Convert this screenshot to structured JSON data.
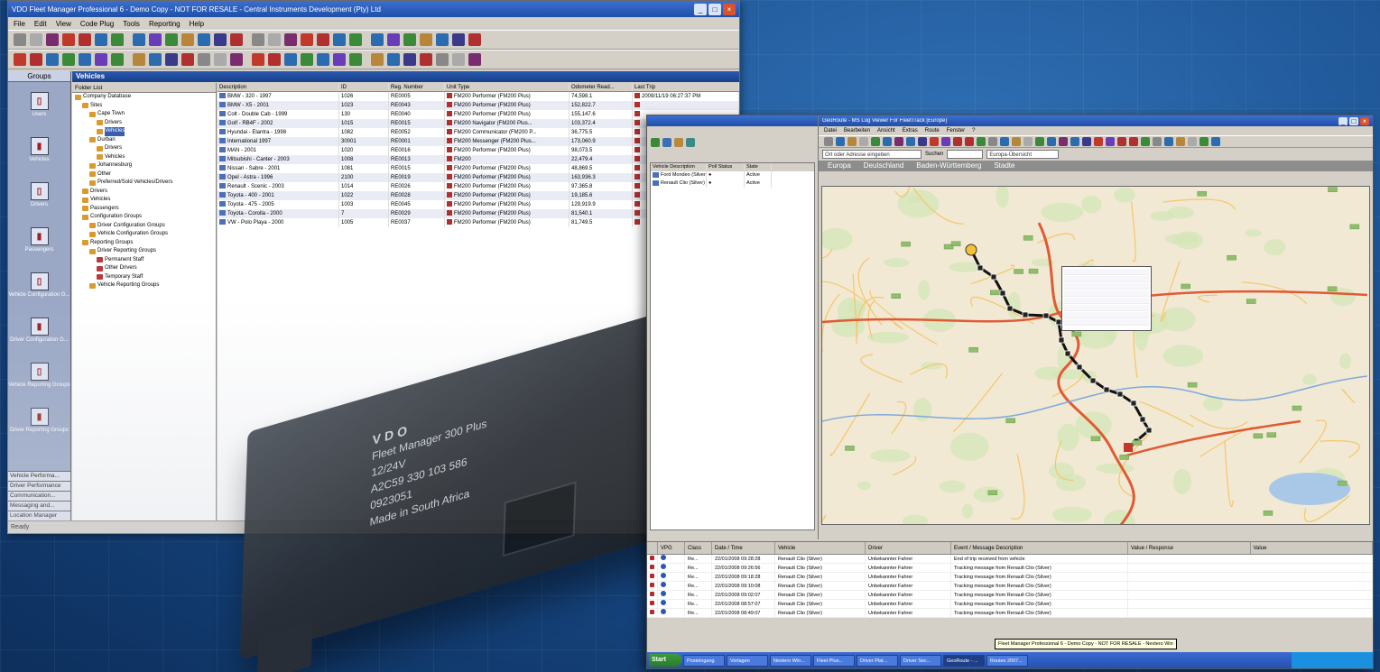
{
  "window1": {
    "title": "VDO Fleet Manager Professional 6 - Demo Copy - NOT FOR RESALE - Central Instruments Development (Pty) Ltd",
    "menu": [
      "File",
      "Edit",
      "View",
      "Code Plug",
      "Tools",
      "Reporting",
      "Help"
    ],
    "nav_header": "Groups",
    "nav_items": [
      "Users",
      "Vehicles",
      "Drivers",
      "Passengers",
      "Vehicle Configuration G...",
      "Driver Configuration G...",
      "Vehicle Reporting Groups",
      "Driver Reporting Groups"
    ],
    "nav_buttons": [
      "Vehicle Performa...",
      "Driver Performance",
      "Communication...",
      "Messaging and...",
      "Location Manager"
    ],
    "pane_title": "Vehicles",
    "folder_list_header": "Folder List",
    "tree": [
      {
        "label": "Company Database",
        "indent": 0
      },
      {
        "label": "Sites",
        "indent": 1
      },
      {
        "label": "Cape Town",
        "indent": 2
      },
      {
        "label": "Drivers",
        "indent": 3
      },
      {
        "label": "Vehicles",
        "indent": 3
      },
      {
        "label": "Durban",
        "indent": 2
      },
      {
        "label": "Drivers",
        "indent": 3
      },
      {
        "label": "Vehicles",
        "indent": 3
      },
      {
        "label": "Johannesburg",
        "indent": 2
      },
      {
        "label": "Other",
        "indent": 2
      },
      {
        "label": "Preferred/Sold Vehicles/Drivers",
        "indent": 2
      },
      {
        "label": "Drivers",
        "indent": 1
      },
      {
        "label": "Vehicles",
        "indent": 1
      },
      {
        "label": "Passengers",
        "indent": 1
      },
      {
        "label": "Configuration Groups",
        "indent": 1
      },
      {
        "label": "Driver Configuration Groups",
        "indent": 2
      },
      {
        "label": "Vehicle Configuration Groups",
        "indent": 2
      },
      {
        "label": "Reporting Groups",
        "indent": 1
      },
      {
        "label": "Driver Reporting Groups",
        "indent": 2
      },
      {
        "label": "Permanent Staff",
        "indent": 3
      },
      {
        "label": "Other Drivers",
        "indent": 3
      },
      {
        "label": "Temporary Staff",
        "indent": 3
      },
      {
        "label": "Vehicle Reporting Groups",
        "indent": 2
      }
    ],
    "table_headers": [
      "Description",
      "ID",
      "Reg. Number",
      "Unit Type",
      "Odometer Read...",
      "Last Trip"
    ],
    "table_rows": [
      [
        "BMW - 320 - 1997",
        "1026",
        "RE0005",
        "FM200 Performer (FM200 Plus)",
        "74,598.1",
        "2009/11/19 06:27:37 PM"
      ],
      [
        "BMW - X5 - 2001",
        "1023",
        "RE0043",
        "FM200 Performer (FM200 Plus)",
        "152,822.7",
        ""
      ],
      [
        "Colt - Double Cab - 1999",
        "130",
        "RE0040",
        "FM200 Performer (FM200 Plus)",
        "155,147.6",
        ""
      ],
      [
        "Golf - RB4F - 2002",
        "1015",
        "RE0015",
        "FM200 Navigator (FM200 Plus...",
        "103,372.4",
        ""
      ],
      [
        "Hyundai - Elantra - 1998",
        "1082",
        "RE0052",
        "FM200 Communicator (FM200 P...",
        "36,775.5",
        ""
      ],
      [
        "International 1997",
        "30001",
        "RE0001",
        "FM200 Messenger (FM200 Plus...",
        "173,060.9",
        ""
      ],
      [
        "MAN - 2001",
        "1020",
        "RE0016",
        "FM200 Performer (FM200 Plus)",
        "98,073.5",
        ""
      ],
      [
        "Mitsubishi - Canter - 2003",
        "1008",
        "RE0013",
        "FM200",
        "22,479.4",
        ""
      ],
      [
        "Nissan - Sabre - 2001",
        "1081",
        "RE0015",
        "FM200 Performer (FM200 Plus)",
        "48,869.5",
        ""
      ],
      [
        "Opel - Astra - 1996",
        "2100",
        "RE0019",
        "FM200 Performer (FM200 Plus)",
        "163,936.3",
        ""
      ],
      [
        "Renault - Scenic - 2003",
        "1014",
        "RE0026",
        "FM200 Performer (FM200 Plus)",
        "97,365.8",
        ""
      ],
      [
        "Toyota - 400 - 2001",
        "1022",
        "RE0028",
        "FM200 Performer (FM200 Plus)",
        "19,185.6",
        ""
      ],
      [
        "Toyota - 475 - 2005",
        "1003",
        "RE0045",
        "FM200 Performer (FM200 Plus)",
        "129,919.9",
        ""
      ],
      [
        "Toyota - Corolla - 2000",
        "7",
        "RE0029",
        "FM200 Performer (FM200 Plus)",
        "81,540.1",
        ""
      ],
      [
        "VW - Polo Playa - 2000",
        "1005",
        "RE0037",
        "FM200 Performer (FM200 Plus)",
        "81,749.5",
        ""
      ]
    ],
    "status": "Ready"
  },
  "device": {
    "brand": "VDO",
    "line1": "Fleet Manager 300 Plus",
    "line2": "12/24V",
    "line3": "A2C59 330 103 586",
    "serial": "0923051",
    "origin": "Made in South Africa"
  },
  "window2": {
    "left_panel": {
      "headers": [
        "Vehicle Description",
        "Poll Status",
        "State"
      ],
      "rows": [
        [
          "Ford Mondeo (Silver)",
          "",
          "Active"
        ],
        [
          "Renault Clio (Silver)",
          "",
          "Active"
        ]
      ]
    },
    "map_window": {
      "title": "GeoRoute - MS Log Viewer For FleetTrack [Europe]",
      "menu": [
        "Datei",
        "Bearbeiten",
        "Ansicht",
        "Extras",
        "Route",
        "Fenster",
        "?"
      ],
      "address_placeholder": "Ort oder Adresse eingeben",
      "search_label": "Suchen",
      "zoom_value": "Europa-Übersicht",
      "breadcrumb": [
        "Europa",
        "Deutschland",
        "Baden-Württemberg",
        "Stadte"
      ]
    },
    "events": {
      "headers": [
        "",
        "VPG",
        "Class",
        "Date / Time",
        "Vehicle",
        "Driver",
        "Event / Message Description",
        "Value / Response",
        "Value"
      ],
      "rows": [
        [
          "I",
          "Re...",
          "22/01/2008 09:28:28",
          "Renault Clio (Silver)",
          "Unbekannter Fahrer",
          "End of trip received from vehicle"
        ],
        [
          "I",
          "Re...",
          "22/01/2008 09:26:56",
          "Renault Clio (Silver)",
          "Unbekannter Fahrer",
          "Tracking message from Renault Clio (Silver)"
        ],
        [
          "I",
          "Re...",
          "22/01/2008 09:18:28",
          "Renault Clio (Silver)",
          "Unbekannter Fahrer",
          "Tracking message from Renault Clio (Silver)"
        ],
        [
          "I",
          "Re...",
          "22/01/2008 09:10:08",
          "Renault Clio (Silver)",
          "Unbekannter Fahrer",
          "Tracking message from Renault Clio (Silver)"
        ],
        [
          "I",
          "Re...",
          "22/01/2008 09:02:07",
          "Renault Clio (Silver)",
          "Unbekannter Fahrer",
          "Tracking message from Renault Clio (Silver)"
        ],
        [
          "I",
          "Re...",
          "22/01/2008 08:57:07",
          "Renault Clio (Silver)",
          "Unbekannter Fahrer",
          "Tracking message from Renault Clio (Silver)"
        ],
        [
          "I",
          "Re...",
          "22/01/2008 08:49:07",
          "Renault Clio (Silver)",
          "Unbekannter Fahrer",
          "Tracking message from Renault Clio (Silver)"
        ]
      ]
    },
    "taskbar": {
      "start": "Start",
      "tasks": [
        "Posteingang",
        "Vorlagen",
        "Nextero Win...",
        "Fleet Plus...",
        "Driver Plat...",
        "Driver Sec...",
        "GeoRoute - ...",
        "Routes 2007..."
      ],
      "tooltip": "Fleet Manager Professional 6 - Demo Copy - NOT FOR RESALE - Nextero Win"
    }
  },
  "colors": {
    "background": "#1a4f8f",
    "titlebar": "#1f4fa8",
    "route": "#111111",
    "highway": "#e05a33"
  }
}
